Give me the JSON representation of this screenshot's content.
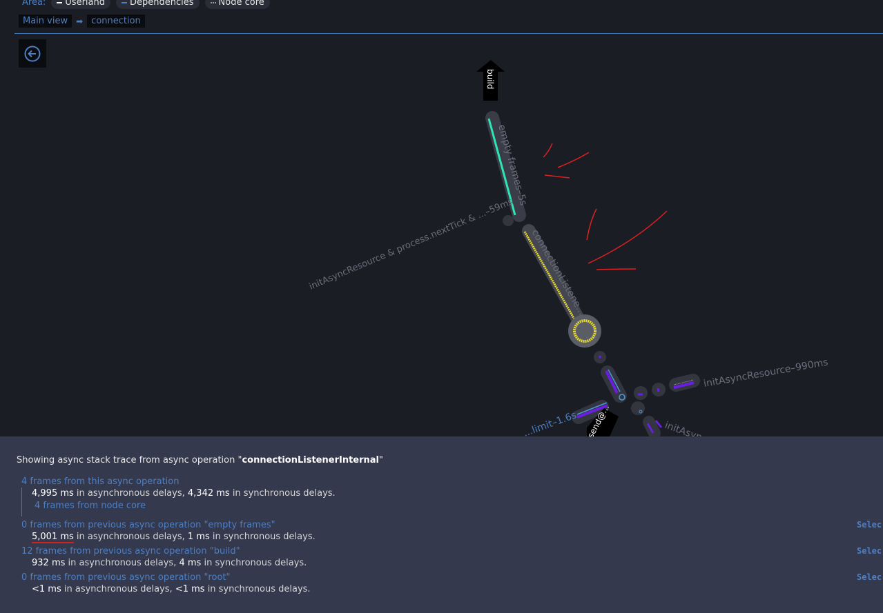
{
  "legend": {
    "label": "Area:",
    "items": [
      {
        "label": "Userland",
        "color": "#ffffff"
      },
      {
        "label": "Dependencies",
        "color": "#4d7fc4"
      },
      {
        "label": "Node core",
        "color": "#999999"
      }
    ]
  },
  "breadcrumb": {
    "items": [
      "Main view",
      "connection"
    ],
    "separator": "➡"
  },
  "graph": {
    "labels": {
      "empty_frames": "empty frames–5s",
      "connection": "connectionListene...",
      "init59": "initAsyncResource & process.nextTick & ...–59ms",
      "init990": "initAsyncResource–990ms",
      "limit": "...limit–1.6s",
      "init_partial": "initAsyn...",
      "build_arrow": "build",
      "send_arrow": "send@..."
    },
    "colors": {
      "empty": "#2ee6b4",
      "connection": "#e6d92e",
      "purple": "#6a1fe0",
      "blue": "#4d9ad8"
    }
  },
  "panel": {
    "title_prefix": "Showing async stack trace from async operation \"",
    "title_op": "connectionListenerInternal",
    "title_suffix": "\"",
    "sections": [
      {
        "head": "4 frames from this async operation",
        "async": "4,995 ms",
        "sync": "4,342 ms",
        "sub": "4 frames from node core"
      },
      {
        "head": "0 frames from previous async operation \"empty frames\"",
        "async": "5,001 ms",
        "sync": "1 ms",
        "select": "Selec"
      },
      {
        "head": "12 frames from previous async operation \"build\"",
        "async": "932 ms",
        "sync": "4 ms",
        "select": "Selec"
      },
      {
        "head": "0 frames from previous async operation \"root\"",
        "async": "<1 ms",
        "sync": "<1 ms",
        "select": "Selec"
      }
    ],
    "async_text": " in asynchronous delays, ",
    "sync_text": " in synchronous delays."
  }
}
